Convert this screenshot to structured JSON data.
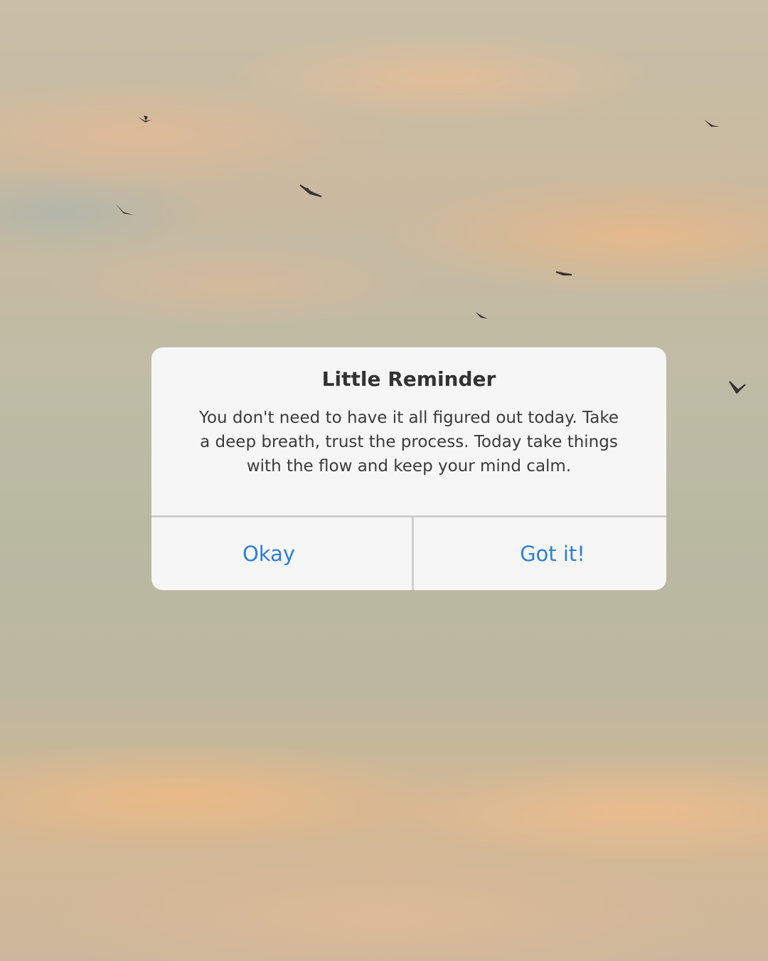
{
  "dialog": {
    "title": "Little Reminder",
    "message": "You don't need to have it all figured out today. Take a deep breath, trust the process. Today take things with the flow and keep your mind calm.",
    "buttons": {
      "okay_label": "Okay",
      "got_it_label": "Got it!"
    }
  },
  "colors": {
    "button_text": "#2e7fd6",
    "dialog_background": "#f6f6f6",
    "title_text": "#333333"
  },
  "background": {
    "scene": "sunset-sky-with-birds"
  }
}
